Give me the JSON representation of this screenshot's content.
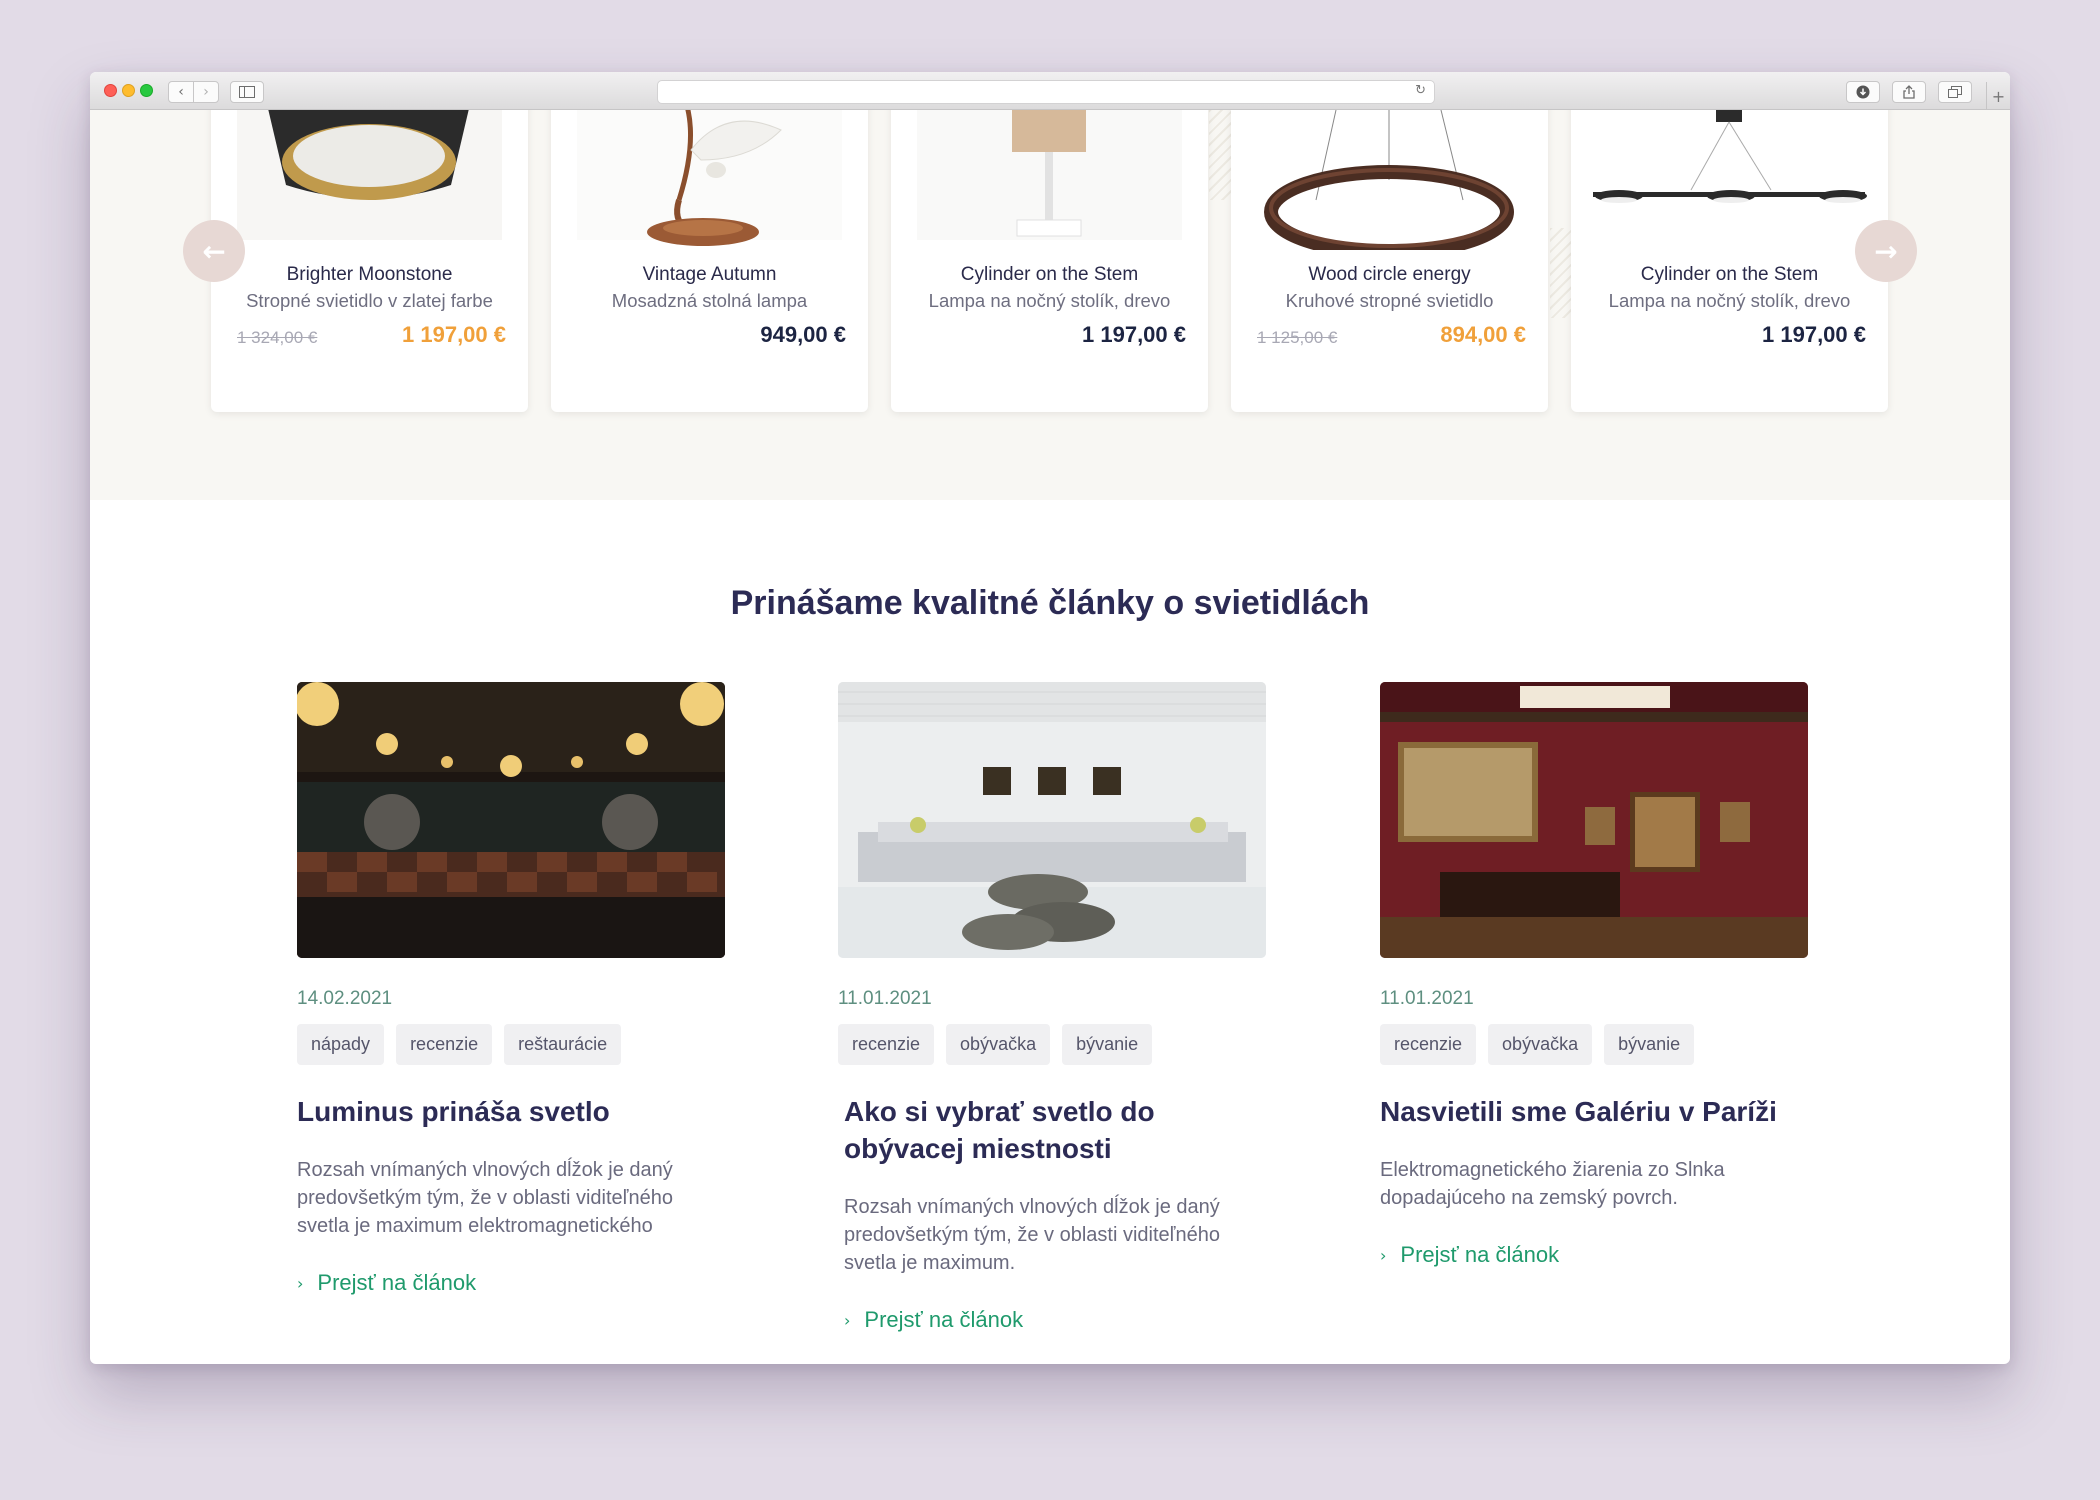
{
  "browser": {
    "nav_back": "‹",
    "nav_forward": "›",
    "address": ""
  },
  "colors": {
    "background": "#e2dbe7",
    "band": "#f8f7f3",
    "sale_price": "#f0a03a",
    "price": "#1c2442",
    "heading": "#2c2b55",
    "link": "#1f9a6c",
    "date": "#5e8f80",
    "arrow_button": "#e7d8d4"
  },
  "carousel": {
    "prev_icon": "arrow-left-icon",
    "next_icon": "arrow-right-icon",
    "products": [
      {
        "name": "Brighter Moonstone",
        "desc": "Stropné svietidlo v zlatej farbe",
        "old_price": "1 324,00 €",
        "price": "1 197,00 €",
        "sale": true
      },
      {
        "name": "Vintage Autumn",
        "desc": "Mosadzná stolná lampa",
        "old_price": "",
        "price": "949,00 €",
        "sale": false
      },
      {
        "name": "Cylinder on the Stem",
        "desc": "Lampa na nočný stolík, drevo",
        "old_price": "",
        "price": "1 197,00 €",
        "sale": false
      },
      {
        "name": "Wood circle energy",
        "desc": "Kruhové stropné svietidlo",
        "old_price": "1 125,00 €",
        "price": "894,00 €",
        "sale": true
      },
      {
        "name": "Cylinder on the Stem",
        "desc": "Lampa na nočný stolík, drevo",
        "old_price": "",
        "price": "1 197,00 €",
        "sale": false
      }
    ]
  },
  "articles_section": {
    "title": "Prinášame kvalitné články o svietidlách",
    "articles": [
      {
        "date": "14.02.2021",
        "tags": [
          "nápady",
          "recenzie",
          "reštaurácie"
        ],
        "title": "Luminus prináša svetlo",
        "text": "Rozsah vnímaných vlnových dĺžok je daný predovšetkým tým, že v oblasti viditeľného svetla je maximum elektromagnetického",
        "link": "Prejsť na článok"
      },
      {
        "date": "11.01.2021",
        "tags": [
          "recenzie",
          "obývačka",
          "bývanie"
        ],
        "title": "Ako si vybrať svetlo do obývacej miestnosti",
        "text": "Rozsah vnímaných vlnových dĺžok je daný predovšetkým tým, že v oblasti viditeľného svetla je maximum.",
        "link": "Prejsť na článok"
      },
      {
        "date": "11.01.2021",
        "tags": [
          "recenzie",
          "obývačka",
          "bývanie"
        ],
        "title": "Nasvietili sme Galériu v Paríži",
        "text": "Elektromagnetického žiarenia zo Slnka dopadajúceho na zemský povrch.",
        "link": "Prejsť na článok"
      }
    ]
  }
}
